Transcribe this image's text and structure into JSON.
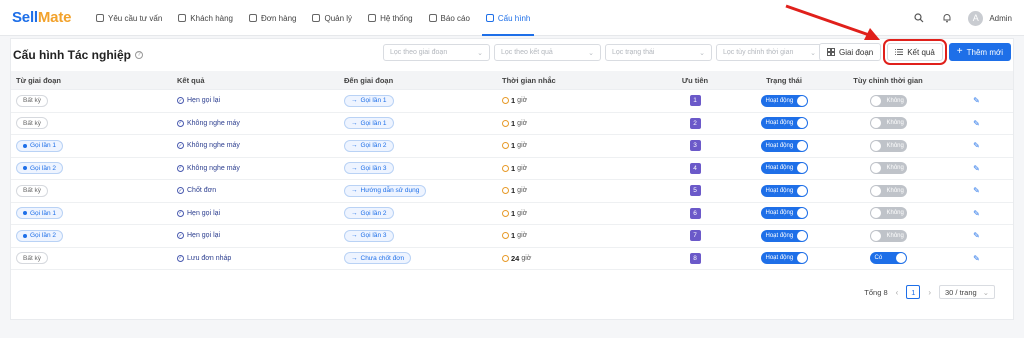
{
  "app": {
    "logo_main": "Sell",
    "logo_accent": "Mate"
  },
  "nav": [
    {
      "label": "Yêu cầu tư vấn",
      "icon": "chat-icon"
    },
    {
      "label": "Khách hàng",
      "icon": "contacts-icon"
    },
    {
      "label": "Đơn hàng",
      "icon": "cart-icon"
    },
    {
      "label": "Quản lý",
      "icon": "grid-icon"
    },
    {
      "label": "Hệ thống",
      "icon": "gear-icon"
    },
    {
      "label": "Báo cáo",
      "icon": "chart-icon"
    },
    {
      "label": "Cấu hình",
      "icon": "pencil-icon",
      "active": true
    }
  ],
  "user": {
    "initial": "A",
    "name": "Admin"
  },
  "page": {
    "title": "Cấu hình Tác nghiệp"
  },
  "filters": {
    "stage": "Lọc theo giai đoạn",
    "result": "Lọc theo kết quả",
    "status": "Lọc trạng thái",
    "custom": "Lọc tùy chỉnh thời gian"
  },
  "toolbar": {
    "stage_btn": "Giai đoạn",
    "result_btn": "Kết quả",
    "add_btn": "Thêm mới"
  },
  "table": {
    "headers": [
      "Từ giai đoạn",
      "Kết quả",
      "Đến giai đoạn",
      "Thời gian nhắc",
      "Ưu tiên",
      "Trạng thái",
      "Tùy chỉnh thời gian"
    ],
    "rows": [
      {
        "from": "Bất kỳ",
        "from_blue": false,
        "result": "Hẹn gọi lại",
        "to": "Gọi lần 1",
        "time": "1",
        "unit": "giờ",
        "prio": "1",
        "status": "Hoạt động",
        "custom": "Không",
        "custom_on": false
      },
      {
        "from": "Bất kỳ",
        "from_blue": false,
        "result": "Không nghe máy",
        "to": "Gọi lần 1",
        "time": "1",
        "unit": "giờ",
        "prio": "2",
        "status": "Hoạt động",
        "custom": "Không",
        "custom_on": false
      },
      {
        "from": "Gọi lần 1",
        "from_blue": true,
        "result": "Không nghe máy",
        "to": "Gọi lần 2",
        "time": "1",
        "unit": "giờ",
        "prio": "3",
        "status": "Hoạt động",
        "custom": "Không",
        "custom_on": false
      },
      {
        "from": "Gọi lần 2",
        "from_blue": true,
        "result": "Không nghe máy",
        "to": "Gọi lần 3",
        "time": "1",
        "unit": "giờ",
        "prio": "4",
        "status": "Hoạt động",
        "custom": "Không",
        "custom_on": false
      },
      {
        "from": "Bất kỳ",
        "from_blue": false,
        "result": "Chốt đơn",
        "to": "Hướng dẫn sử dụng",
        "time": "1",
        "unit": "giờ",
        "prio": "5",
        "status": "Hoạt động",
        "custom": "Không",
        "custom_on": false
      },
      {
        "from": "Gọi lần 1",
        "from_blue": true,
        "result": "Hẹn gọi lại",
        "to": "Gọi lần 2",
        "time": "1",
        "unit": "giờ",
        "prio": "6",
        "status": "Hoạt động",
        "custom": "Không",
        "custom_on": false
      },
      {
        "from": "Gọi lần 2",
        "from_blue": true,
        "result": "Hẹn gọi lại",
        "to": "Gọi lần 3",
        "time": "1",
        "unit": "giờ",
        "prio": "7",
        "status": "Hoạt động",
        "custom": "Không",
        "custom_on": false
      },
      {
        "from": "Bất kỳ",
        "from_blue": false,
        "result": "Lưu đơn nháp",
        "to": "Chưa chốt đơn",
        "time": "24",
        "unit": "giờ",
        "prio": "8",
        "status": "Hoạt động",
        "custom": "Có",
        "custom_on": true
      }
    ]
  },
  "pagination": {
    "total_label": "Tổng 8",
    "current": "1",
    "page_size": "30 / trang"
  },
  "colors": {
    "accent": "#1e6fe8",
    "priority": "#6b59c9",
    "annotation": "#e0201b"
  }
}
